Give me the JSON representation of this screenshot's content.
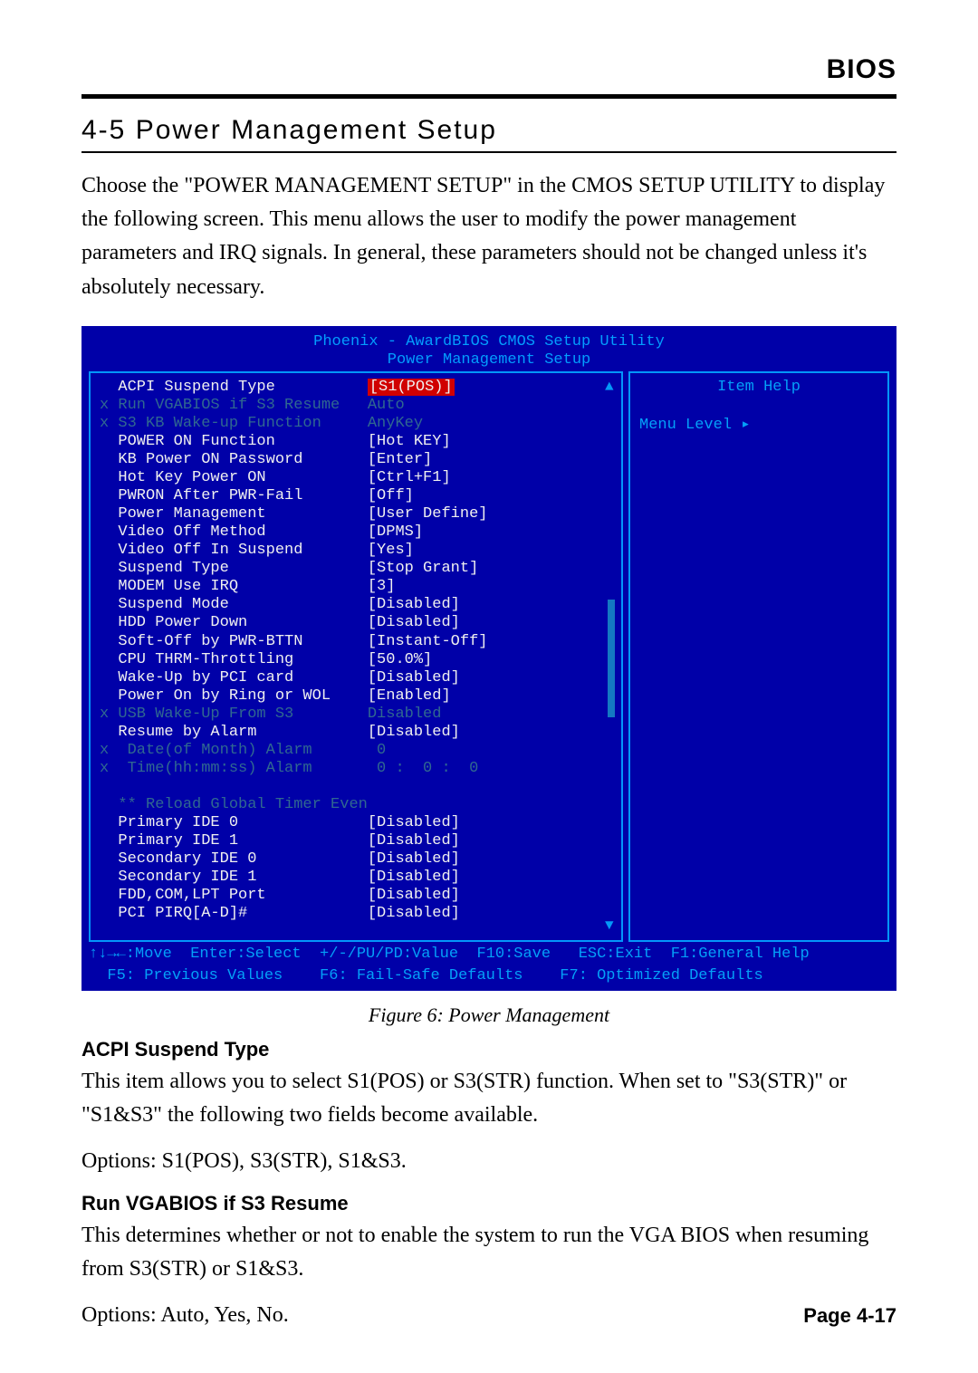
{
  "header": {
    "right": "BIOS"
  },
  "section": {
    "title": "4-5 Power Management Setup"
  },
  "intro": "Choose the \"POWER MANAGEMENT SETUP\" in the CMOS SETUP UTILITY to display the following screen. This menu allows the user to modify the power management parameters and IRQ signals. In general, these parameters should not be changed unless it's absolutely necessary.",
  "bios": {
    "title1": "Phoenix - AwardBIOS CMOS Setup Utility",
    "title2": "Power Management Setup",
    "helpTitle": "Item Help",
    "menuLevel": "Menu Level   ▸",
    "rows": [
      {
        "x": " ",
        "label": "ACPI Suspend Type",
        "val": "[S1(POS)]",
        "cls": "white",
        "hi": true
      },
      {
        "x": "x",
        "label": "Run VGABIOS if S3 Resume",
        "val": "Auto",
        "cls": "grey"
      },
      {
        "x": "x",
        "label": "S3 KB Wake-up Function",
        "val": "AnyKey",
        "cls": "grey"
      },
      {
        "x": " ",
        "label": "POWER ON Function",
        "val": "[Hot KEY]",
        "cls": "white"
      },
      {
        "x": " ",
        "label": "KB Power ON Password",
        "val": "[Enter]",
        "cls": "white"
      },
      {
        "x": " ",
        "label": "Hot Key Power ON",
        "val": "[Ctrl+F1]",
        "cls": "white"
      },
      {
        "x": " ",
        "label": "PWRON After PWR-Fail",
        "val": "[Off]",
        "cls": "white"
      },
      {
        "x": " ",
        "label": "Power Management",
        "val": "[User Define]",
        "cls": "white"
      },
      {
        "x": " ",
        "label": "Video Off Method",
        "val": "[DPMS]",
        "cls": "white"
      },
      {
        "x": " ",
        "label": "Video Off In Suspend",
        "val": "[Yes]",
        "cls": "white"
      },
      {
        "x": " ",
        "label": "Suspend Type",
        "val": "[Stop Grant]",
        "cls": "white"
      },
      {
        "x": " ",
        "label": "MODEM Use IRQ",
        "val": "[3]",
        "cls": "white"
      },
      {
        "x": " ",
        "label": "Suspend Mode",
        "val": "[Disabled]",
        "cls": "white"
      },
      {
        "x": " ",
        "label": "HDD Power Down",
        "val": "[Disabled]",
        "cls": "white"
      },
      {
        "x": " ",
        "label": "Soft-Off by PWR-BTTN",
        "val": "[Instant-Off]",
        "cls": "white"
      },
      {
        "x": " ",
        "label": "CPU THRM-Throttling",
        "val": "[50.0%]",
        "cls": "white"
      },
      {
        "x": " ",
        "label": "Wake-Up by PCI card",
        "val": "[Disabled]",
        "cls": "white"
      },
      {
        "x": " ",
        "label": "Power On by Ring or WOL",
        "val": "[Enabled]",
        "cls": "white"
      },
      {
        "x": "x",
        "label": "USB Wake-Up From S3",
        "val": "Disabled",
        "cls": "grey"
      },
      {
        "x": " ",
        "label": "Resume by Alarm",
        "val": "[Disabled]",
        "cls": "white"
      },
      {
        "x": "x",
        "label": " Date(of Month) Alarm",
        "val": " 0",
        "cls": "grey"
      },
      {
        "x": "x",
        "label": " Time(hh:mm:ss) Alarm",
        "val": " 0 :  0 :  0",
        "cls": "grey"
      },
      {
        "x": " ",
        "label": "",
        "val": "",
        "cls": "white"
      },
      {
        "x": " ",
        "label": "** Reload Global Timer Events **",
        "val": "",
        "cls": "grey"
      },
      {
        "x": " ",
        "label": "Primary IDE 0",
        "val": "[Disabled]",
        "cls": "white"
      },
      {
        "x": " ",
        "label": "Primary IDE 1",
        "val": "[Disabled]",
        "cls": "white"
      },
      {
        "x": " ",
        "label": "Secondary IDE 0",
        "val": "[Disabled]",
        "cls": "white"
      },
      {
        "x": " ",
        "label": "Secondary IDE 1",
        "val": "[Disabled]",
        "cls": "white"
      },
      {
        "x": " ",
        "label": "FDD,COM,LPT Port",
        "val": "[Disabled]",
        "cls": "white"
      },
      {
        "x": " ",
        "label": "PCI PIRQ[A-D]#",
        "val": "[Disabled]",
        "cls": "white"
      }
    ],
    "footer1": "↑↓→←:Move  Enter:Select  +/-/PU/PD:Value  F10:Save   ESC:Exit  F1:General Help",
    "footer2": "  F5: Previous Values    F6: Fail-Safe Defaults    F7: Optimized Defaults"
  },
  "caption": "Figure 6: Power Management",
  "desc1": {
    "hd": "ACPI Suspend Type",
    "p1": "This item allows you to select S1(POS) or S3(STR) function. When set to \"S3(STR)\" or \"S1&S3\" the following two fields become available.",
    "p2": "Options: S1(POS), S3(STR), S1&S3."
  },
  "desc2": {
    "hd": "Run VGABIOS if S3 Resume",
    "p1": "This determines whether or not to enable the system to run the VGA BIOS when resuming from S3(STR) or S1&S3.",
    "p2": "Options: Auto, Yes, No."
  },
  "pagenum": "Page 4-17"
}
